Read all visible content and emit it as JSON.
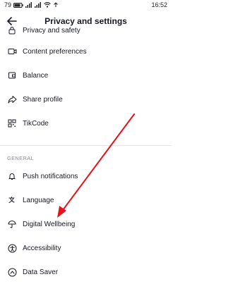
{
  "status_bar": {
    "battery": "79",
    "time": "16:52"
  },
  "header": {
    "title": "Privacy and settings"
  },
  "menu_top": [
    {
      "label": "Privacy and safety",
      "icon": "lock-icon"
    },
    {
      "label": "Content preferences",
      "icon": "video-icon"
    },
    {
      "label": "Balance",
      "icon": "wallet-icon"
    },
    {
      "label": "Share profile",
      "icon": "share-icon"
    },
    {
      "label": "TikCode",
      "icon": "qr-code-icon"
    }
  ],
  "section_general": {
    "label": "GENERAL"
  },
  "menu_general": [
    {
      "label": "Push notifications",
      "icon": "bell-icon"
    },
    {
      "label": "Language",
      "icon": "globe-icon"
    },
    {
      "label": "Digital Wellbeing",
      "icon": "umbrella-icon"
    },
    {
      "label": "Accessibility",
      "icon": "accessibility-icon"
    },
    {
      "label": "Data Saver",
      "icon": "data-saver-icon"
    }
  ],
  "annotation": {
    "arrow_color": "#e8121b"
  }
}
